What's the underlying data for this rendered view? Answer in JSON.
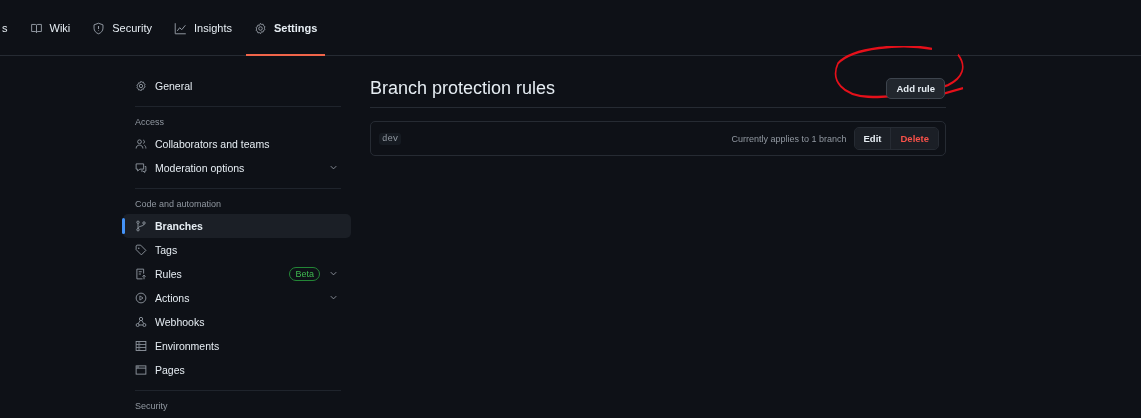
{
  "repo_tabs": [
    {
      "label": "s",
      "selected": false
    },
    {
      "label": "Wiki",
      "selected": false
    },
    {
      "label": "Security",
      "selected": false
    },
    {
      "label": "Insights",
      "selected": false
    },
    {
      "label": "Settings",
      "selected": true
    }
  ],
  "sidebar": {
    "items": [
      {
        "kind": "item",
        "label": "General",
        "selected": false
      },
      {
        "kind": "divider"
      },
      {
        "kind": "header",
        "label": "Access"
      },
      {
        "kind": "item",
        "label": "Collaborators and teams",
        "selected": false
      },
      {
        "kind": "item",
        "label": "Moderation options",
        "selected": false,
        "expanded": false
      },
      {
        "kind": "divider"
      },
      {
        "kind": "header",
        "label": "Code and automation"
      },
      {
        "kind": "item",
        "label": "Branches",
        "selected": true
      },
      {
        "kind": "item",
        "label": "Tags",
        "selected": false
      },
      {
        "kind": "item",
        "label": "Rules",
        "selected": false,
        "badge": "Beta",
        "expanded": false
      },
      {
        "kind": "item",
        "label": "Actions",
        "selected": false,
        "expanded": false
      },
      {
        "kind": "item",
        "label": "Webhooks",
        "selected": false
      },
      {
        "kind": "item",
        "label": "Environments",
        "selected": false
      },
      {
        "kind": "item",
        "label": "Pages",
        "selected": false
      },
      {
        "kind": "divider"
      },
      {
        "kind": "header",
        "label": "Security"
      }
    ]
  },
  "main": {
    "title": "Branch protection rules",
    "add_button": "Add rule",
    "rules": [
      {
        "pattern": "dev",
        "applies": "Currently applies to 1 branch",
        "edit": "Edit",
        "delete": "Delete"
      }
    ]
  }
}
